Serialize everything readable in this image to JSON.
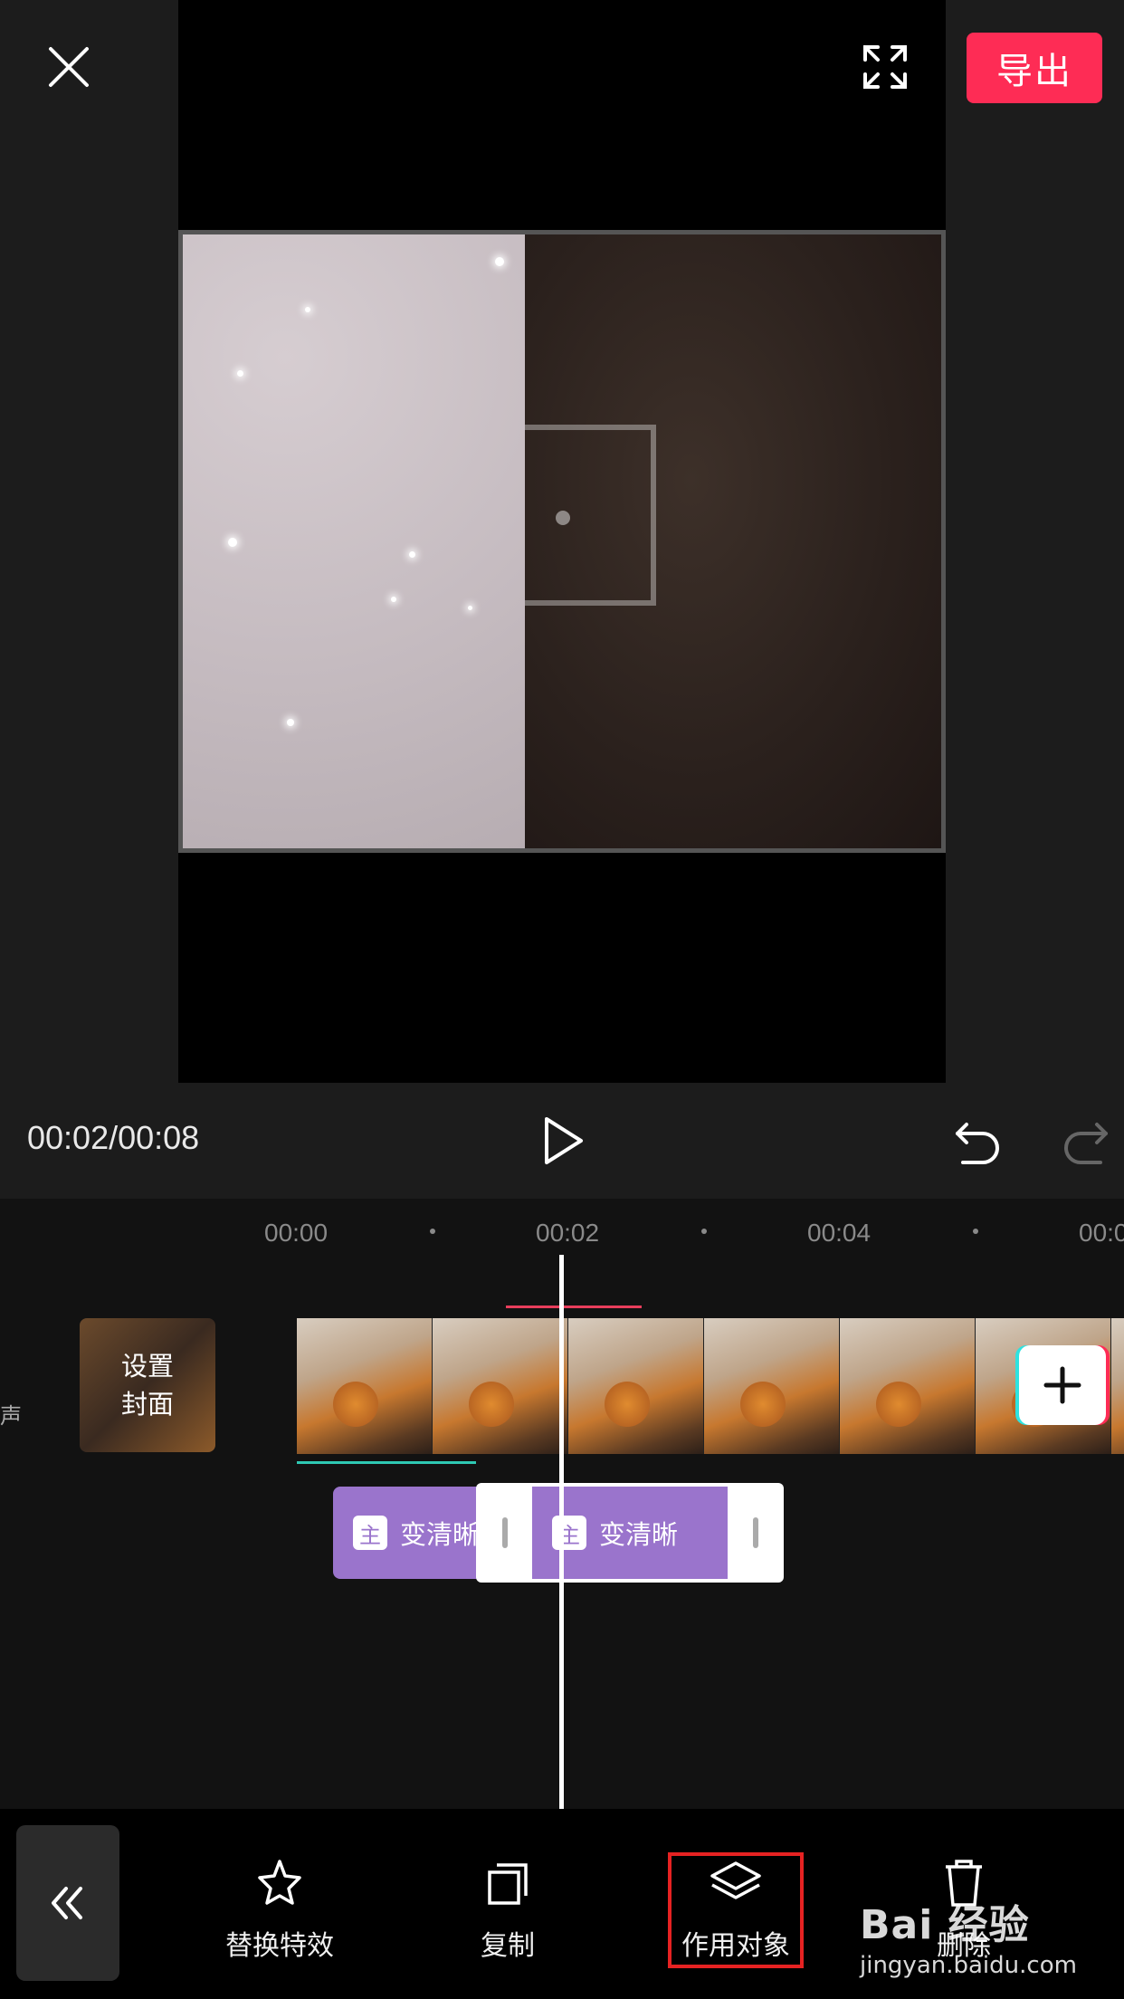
{
  "header": {
    "export_label": "导出"
  },
  "player": {
    "timecode": "00:02/00:08"
  },
  "timeline": {
    "ruler": [
      "00:00",
      "00:02",
      "00:04",
      "00:0"
    ],
    "track_label": "声",
    "cover_label": "设置 封面",
    "effect_clips": [
      {
        "badge": "主",
        "label": "变清晰"
      },
      {
        "badge": "主",
        "label": "变清晰"
      }
    ]
  },
  "toolbar": {
    "items": [
      {
        "label": "替换特效",
        "icon": "sparkle-icon"
      },
      {
        "label": "复制",
        "icon": "copy-icon"
      },
      {
        "label": "作用对象",
        "icon": "layers-icon"
      },
      {
        "label": "删除",
        "icon": "trash-icon"
      }
    ]
  },
  "watermark": {
    "logo": "Bai 经验",
    "url": "jingyan.baidu.com"
  },
  "colors": {
    "accent": "#fe2c55",
    "effect": "#9a74cc",
    "highlight": "#e62222"
  }
}
